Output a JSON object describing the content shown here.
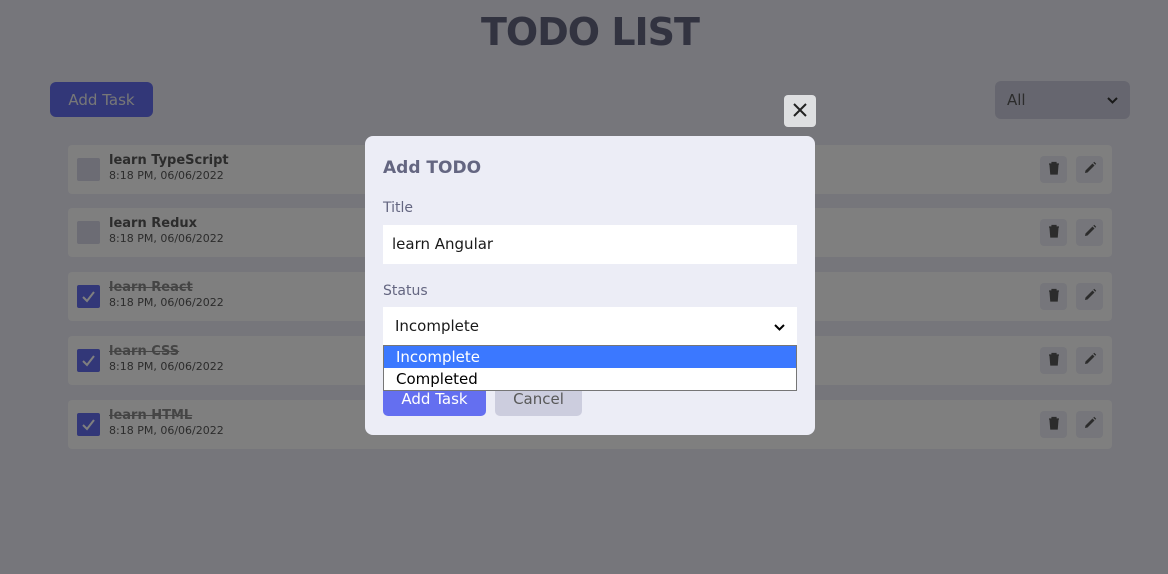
{
  "app": {
    "title": "TODO LIST",
    "add_task_label": "Add Task",
    "filter": {
      "selected": "All"
    }
  },
  "todos": [
    {
      "title": "learn TypeScript",
      "time": "8:18 PM, 06/06/2022",
      "completed": false
    },
    {
      "title": "learn Redux",
      "time": "8:18 PM, 06/06/2022",
      "completed": false
    },
    {
      "title": "learn React",
      "time": "8:18 PM, 06/06/2022",
      "completed": true
    },
    {
      "title": "learn CSS",
      "time": "8:18 PM, 06/06/2022",
      "completed": true
    },
    {
      "title": "learn HTML",
      "time": "8:18 PM, 06/06/2022",
      "completed": true
    }
  ],
  "modal": {
    "heading": "Add TODO",
    "title_label": "Title",
    "title_value": "learn Angular",
    "status_label": "Status",
    "status_value": "Incomplete",
    "status_options": [
      "Incomplete",
      "Completed"
    ],
    "submit_label": "Add Task",
    "cancel_label": "Cancel"
  },
  "colors": {
    "accent": "#646ff0",
    "background": "#ecedf6",
    "text": "#646681",
    "highlight": "#3b78ff"
  },
  "icons": [
    "trash-icon",
    "pencil-icon",
    "check-icon",
    "close-icon",
    "chevron-down-icon"
  ]
}
